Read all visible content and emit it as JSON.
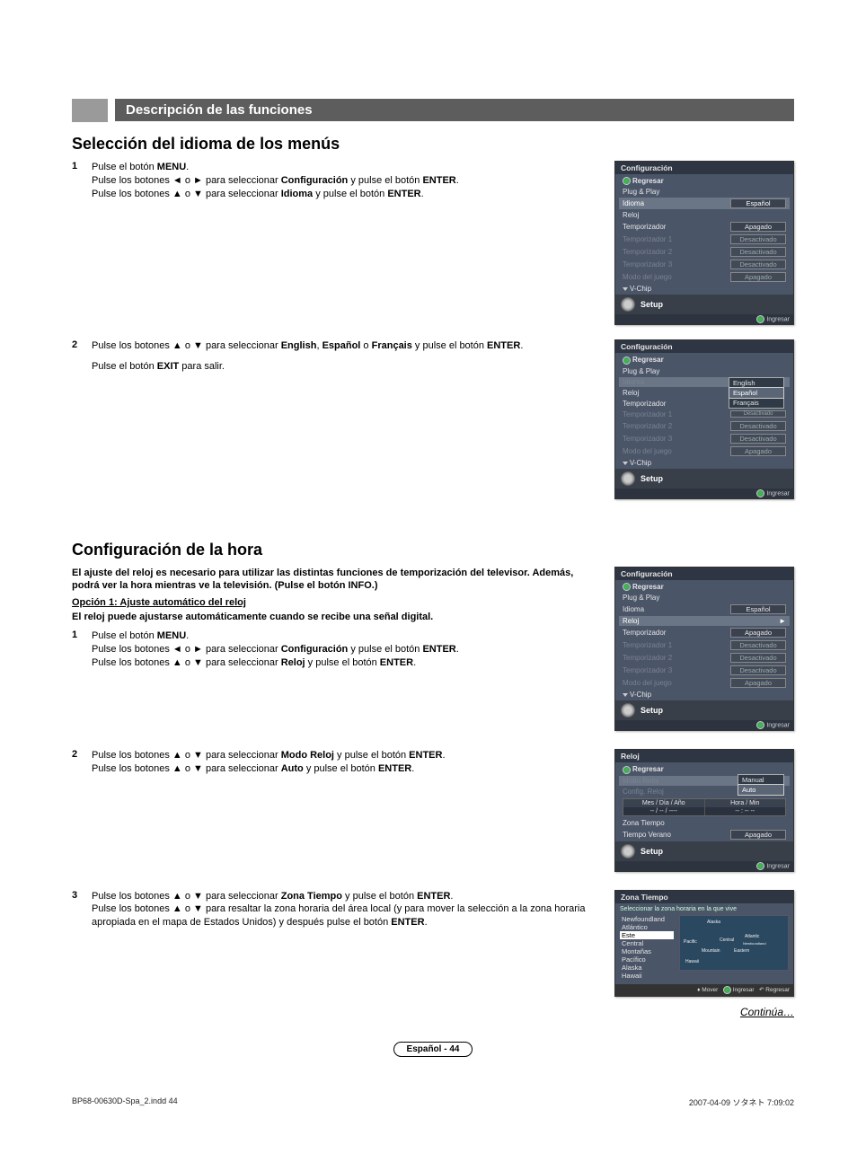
{
  "header": {
    "section_bar": "Descripción de las funciones"
  },
  "sec1": {
    "title": "Selección del idioma de los menús",
    "step1_num": "1",
    "step1_a": "Pulse el botón ",
    "step1_b": "MENU",
    "step1_c": ".",
    "step1_d": "Pulse los botones ◄ o ► para seleccionar ",
    "step1_e": "Configuración",
    "step1_f": " y pulse el botón ",
    "step1_g": "ENTER",
    "step1_h": ".",
    "step1_i": "Pulse los botones ▲ o ▼ para seleccionar ",
    "step1_j": "Idioma",
    "step1_k": " y pulse el botón ",
    "step1_l": "ENTER",
    "step1_m": ".",
    "step2_num": "2",
    "step2_a": "Pulse los botones ▲ o ▼ para seleccionar ",
    "step2_b": "English",
    "step2_c": ", ",
    "step2_d": "Español",
    "step2_e": " o ",
    "step2_f": "Français",
    "step2_g": " y pulse el botón ",
    "step2_h": "ENTER",
    "step2_i": ".",
    "step2_j": "Pulse el botón ",
    "step2_k": "EXIT",
    "step2_l": " para salir."
  },
  "sec2": {
    "title": "Configuración de la hora",
    "intro": "El ajuste del reloj es necesario para utilizar las distintas funciones de temporización del televisor. Además, podrá ver la hora mientras ve la televisión. (Pulse el botón INFO.)",
    "option_hdr": "Opción 1: Ajuste automático del reloj",
    "note": "El reloj puede ajustarse automáticamente cuando se recibe una señal digital.",
    "s1_num": "1",
    "s1_a": "Pulse el botón ",
    "s1_b": "MENU",
    "s1_c": ".",
    "s1_d": "Pulse los botones ◄ o ► para seleccionar ",
    "s1_e": "Configuración",
    "s1_f": " y pulse el botón ",
    "s1_g": "ENTER",
    "s1_h": ".",
    "s1_i": "Pulse los botones ▲ o ▼ para seleccionar ",
    "s1_j": "Reloj",
    "s1_k": " y pulse el botón ",
    "s1_l": "ENTER",
    "s1_m": ".",
    "s2_num": "2",
    "s2_a": "Pulse los botones ▲ o ▼ para seleccionar ",
    "s2_b": "Modo Reloj",
    "s2_c": " y pulse el botón ",
    "s2_d": "ENTER",
    "s2_e": ".",
    "s2_f": "Pulse los botones ▲ o ▼ para seleccionar ",
    "s2_g": "Auto",
    "s2_h": " y pulse el botón ",
    "s2_i": "ENTER",
    "s2_j": ".",
    "s3_num": "3",
    "s3_a": "Pulse los botones ▲ o ▼ para seleccionar ",
    "s3_b": "Zona Tiempo",
    "s3_c": " y pulse el botón ",
    "s3_d": "ENTER",
    "s3_e": ".",
    "s3_f": "Pulse los botones ▲ o ▼ para resaltar la zona horaria del área local (y para mover la selección a la zona horaria apropiada en el mapa de Estados Unidos) y después pulse el botón ",
    "s3_g": "ENTER",
    "s3_h": "."
  },
  "osd_common": {
    "regresar": "Regresar",
    "plugplay": "Plug & Play",
    "idioma": "Idioma",
    "reloj": "Reloj",
    "temporizador": "Temporizador",
    "temp1": "Temporizador 1",
    "temp2": "Temporizador 2",
    "temp3": "Temporizador 3",
    "modojuego": "Modo del juego",
    "vchip": "V-Chip",
    "setup": "Setup",
    "ingresar": "Ingresar",
    "espanol": "Español",
    "apagado": "Apagado",
    "desactivado": "Desactivado",
    "configuracion": "Configuración",
    "english": "English",
    "francais": "Français"
  },
  "osd_reloj": {
    "header": "Reloj",
    "modoreloj": "Modo Reloj",
    "configreloj": "Config. Reloj",
    "manual": "Manual",
    "auto": "Auto",
    "mesdiaano": "Mes / Día / Año",
    "horamin": "Hora / Min",
    "dashes1": "-- / -- / ----",
    "dashes2": "-- : --  --",
    "zonatiempo": "Zona Tiempo",
    "tiempoverano": "Tiempo Verano"
  },
  "osd_zona": {
    "header": "Zona Tiempo",
    "prompt": "Seleccionar la zona horaria en la que vive",
    "zones": [
      "Newfoundland",
      "Atlántico",
      "Este",
      "Central",
      "Montañas",
      "Pacífico",
      "Alaska",
      "Hawaii"
    ],
    "selected": "Este",
    "mover": "Mover",
    "ingresar": "Ingresar",
    "regresar": "Regresar",
    "map_labels": [
      "Alaska",
      "Pacific",
      "Mountain",
      "Central",
      "Eastern",
      "Atlantic",
      "Newfoundland",
      "Hawaii"
    ]
  },
  "continua": "Continúa…",
  "page_number": "Español - 44",
  "footer": {
    "left": "BP68-00630D-Spa_2.indd   44",
    "right": "2007-04-09   ソタネト 7:09:02"
  }
}
